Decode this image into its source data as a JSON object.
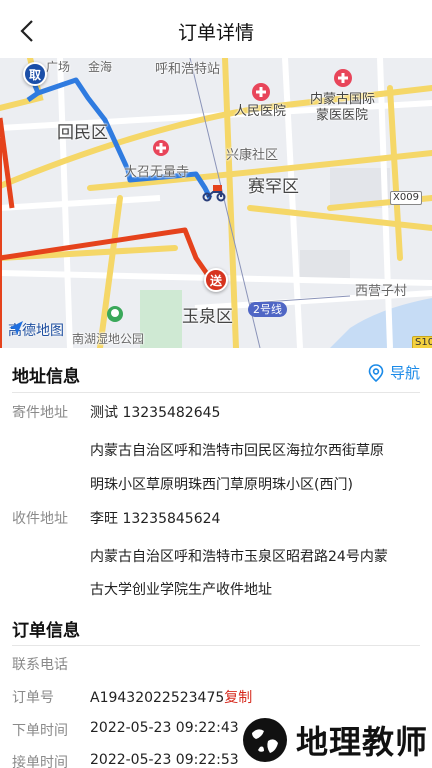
{
  "header": {
    "title": "订单详情"
  },
  "map": {
    "labels": {
      "hohhot_station": "呼和浩特站",
      "huimin": "回民区",
      "saihan": "赛罕区",
      "yuquan": "玉泉区",
      "xingkang": "兴康社区",
      "dazhao": "大召无量寺",
      "xiyingzi": "西营子村",
      "wetland": "南湖湿地公园",
      "plaza": "广场",
      "jinhai": "金海"
    },
    "hospitals": {
      "renmin": "人民医院",
      "mengyi_line1": "内蒙古国际",
      "mengyi_line2": "蒙医医院"
    },
    "road_tags": {
      "x009": "X009",
      "s10": "S10",
      "metro2": "2号线"
    },
    "markers": {
      "pickup": "取",
      "deliver": "送"
    },
    "logo": "高德地图",
    "colors": {
      "route_blue": "#2f7be0",
      "route_red": "#e5421c",
      "road_yellow": "#f7d95a"
    }
  },
  "address": {
    "title": "地址信息",
    "nav_label": "导航",
    "sender_label": "寄件地址",
    "sender_contact": "测试 13235482645",
    "sender_addr_line1": "内蒙古自治区呼和浩特市回民区海拉尔西街草原",
    "sender_addr_line2": "明珠小区草原明珠西门草原明珠小区(西门)",
    "receiver_label": "收件地址",
    "receiver_contact": "李旺 13235845624",
    "receiver_addr_line1": "内蒙古自治区呼和浩特市玉泉区昭君路24号内蒙",
    "receiver_addr_line2": "古大学创业学院生产收件地址"
  },
  "order": {
    "title": "订单信息",
    "phone_label": "联系电话",
    "phone_value": "",
    "number_label": "订单号",
    "number_value": "A19432022523475",
    "copy_label": "复制",
    "created_label": "下单时间",
    "created_value": "2022-05-23 09:22:43",
    "accepted_label": "接单时间",
    "accepted_value": "2022-05-23 09:22:53"
  },
  "watermark": {
    "text": "地理教师"
  }
}
